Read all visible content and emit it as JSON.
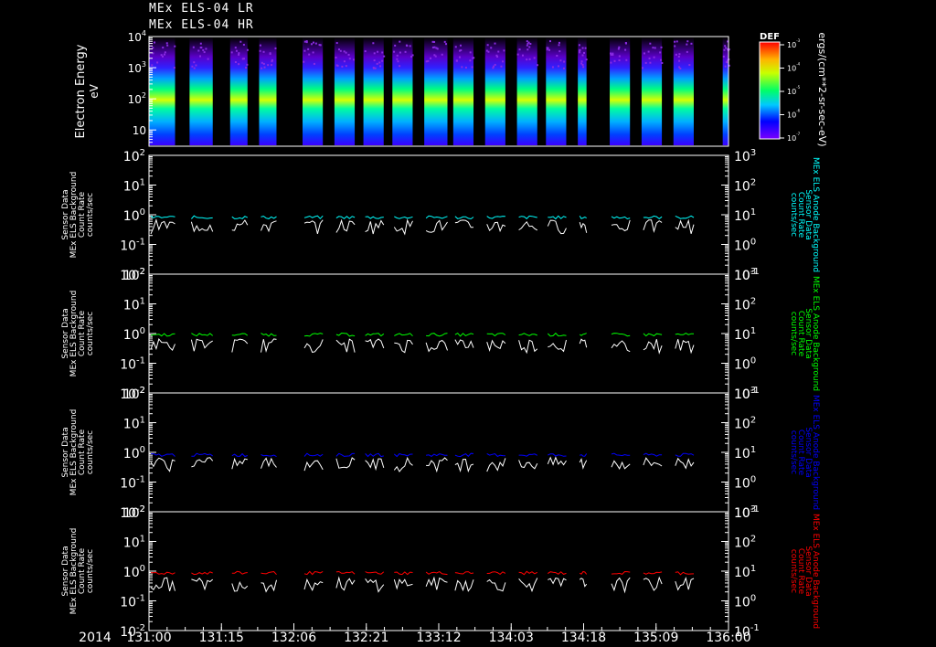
{
  "titles": [
    "MEx ELS-04 LR",
    "MEx ELS-04 HR"
  ],
  "spectrogram": {
    "ylabel": "Electron Energy",
    "yunit": "eV",
    "yticks": [
      "10",
      "10",
      "10",
      "10"
    ],
    "yticks_exp": [
      "4",
      "3",
      "2",
      ""
    ],
    "colorbar_label": "DEF",
    "colorbar_unit": "ergs/(cm**2-sr-sec-eV)",
    "colorbar_ticks": [
      "10",
      "10",
      "10",
      "10",
      "10"
    ],
    "colorbar_ticks_exp": [
      "-3",
      "-4",
      "-5",
      "-6",
      "-7"
    ]
  },
  "count_panels": [
    {
      "left_label": [
        "Sensor Data",
        "MEx ELS Background",
        "Count Rate",
        "counts/sec"
      ],
      "right_label": [
        "MEx ELS Anode Background",
        "Sensor Data",
        "Count Rate",
        "counts/sec"
      ],
      "color": "#00ffff"
    },
    {
      "left_label": [
        "Sensor Data",
        "MEx ELS Background",
        "Count Rate",
        "counts/sec"
      ],
      "right_label": [
        "MEx ELS Anode Background",
        "Sensor Data",
        "Count Rate",
        "counts/sec"
      ],
      "color": "#00ff00"
    },
    {
      "left_label": [
        "Sensor Data",
        "MEx ELS Background",
        "Count Rate",
        "counts/sec"
      ],
      "right_label": [
        "MEx ELS Anode Background",
        "Sensor Data",
        "Count Rate",
        "counts/sec"
      ],
      "color": "#0000ff"
    },
    {
      "left_label": [
        "Sensor Data",
        "MEx ELS Background",
        "Count Rate",
        "counts/sec"
      ],
      "right_label": [
        "MEx ELS Anode Background",
        "Sensor Data",
        "Count Rate",
        "counts/sec"
      ],
      "color": "#ff0000"
    }
  ],
  "left_ticks": [
    {
      "base": "10",
      "exp": "2"
    },
    {
      "base": "10",
      "exp": "1"
    },
    {
      "base": "10",
      "exp": "0"
    },
    {
      "base": "10",
      "exp": "-1"
    },
    {
      "base": "10",
      "exp": "-2"
    }
  ],
  "right_ticks": [
    {
      "base": "10",
      "exp": "3"
    },
    {
      "base": "10",
      "exp": "2"
    },
    {
      "base": "10",
      "exp": "1"
    },
    {
      "base": "10",
      "exp": "0"
    },
    {
      "base": "10",
      "exp": "-1"
    }
  ],
  "year": "2014",
  "x_ticks": [
    "131:00",
    "131:15",
    "132:06",
    "132:21",
    "133:12",
    "134:03",
    "134:18",
    "135:09",
    "136:00"
  ],
  "chart_data": {
    "type": "line",
    "description_free": true,
    "x_domain": [
      "131:00",
      "136:00"
    ],
    "data_intervals": [
      [
        0.0,
        0.045
      ],
      [
        0.07,
        0.11
      ],
      [
        0.14,
        0.17
      ],
      [
        0.19,
        0.22
      ],
      [
        0.265,
        0.3
      ],
      [
        0.32,
        0.355
      ],
      [
        0.37,
        0.405
      ],
      [
        0.42,
        0.455
      ],
      [
        0.475,
        0.515
      ],
      [
        0.525,
        0.56
      ],
      [
        0.58,
        0.615
      ],
      [
        0.635,
        0.67
      ],
      [
        0.685,
        0.72
      ],
      [
        0.74,
        0.755
      ],
      [
        0.795,
        0.83
      ],
      [
        0.85,
        0.885
      ],
      [
        0.905,
        0.94
      ],
      [
        0.99,
        1.0
      ]
    ],
    "series": [
      {
        "panel": 0,
        "upper": 0.8,
        "lower": 0.5
      },
      {
        "panel": 1,
        "upper": 0.9,
        "lower": 0.5
      },
      {
        "panel": 2,
        "upper": 0.8,
        "lower": 0.5
      },
      {
        "panel": 3,
        "upper": 0.85,
        "lower": 0.45
      }
    ],
    "count_ylim_left": [
      0.01,
      100
    ],
    "count_ylim_right": [
      0.1,
      1000
    ],
    "energy_ylim": [
      3,
      10000
    ],
    "energy_yscale": "log",
    "count_yscale": "log"
  }
}
